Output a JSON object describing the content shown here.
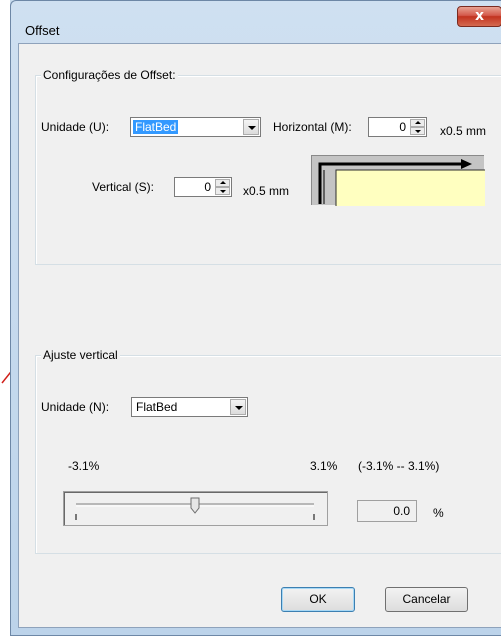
{
  "window": {
    "title": "Offset",
    "close_glyph": "x"
  },
  "offset_group": {
    "label": "Configurações de Offset:",
    "unit_label": "Unidade (U):",
    "unit_value": "FlatBed",
    "horizontal_label": "Horizontal (M):",
    "horizontal_value": "0",
    "horizontal_unit": "x0.5 mm",
    "vertical_label": "Vertical (S):",
    "vertical_value": "0",
    "vertical_unit": "x0.5 mm"
  },
  "vertical_adjust_group": {
    "label": "Ajuste vertical",
    "unit_label": "Unidade (N):",
    "unit_value": "FlatBed",
    "min_label": "-3.1%",
    "max_label": "3.1%",
    "range_label": "(-3.1% -- 3.1%)",
    "slider_fraction": 0.5,
    "value": "0.0",
    "percent_symbol": "%"
  },
  "buttons": {
    "ok": "OK",
    "cancel": "Cancelar"
  },
  "colors": {
    "title_bar": "#c9dcee",
    "close_button": "#c2321f",
    "selection": "#3399ff",
    "preview_highlight": "#ffffc0"
  },
  "icons": {
    "close": "close-icon",
    "combo_arrow": "chevron-down-icon",
    "spin": "spin-updown-icon",
    "annotation": "red-arrow-icon"
  }
}
